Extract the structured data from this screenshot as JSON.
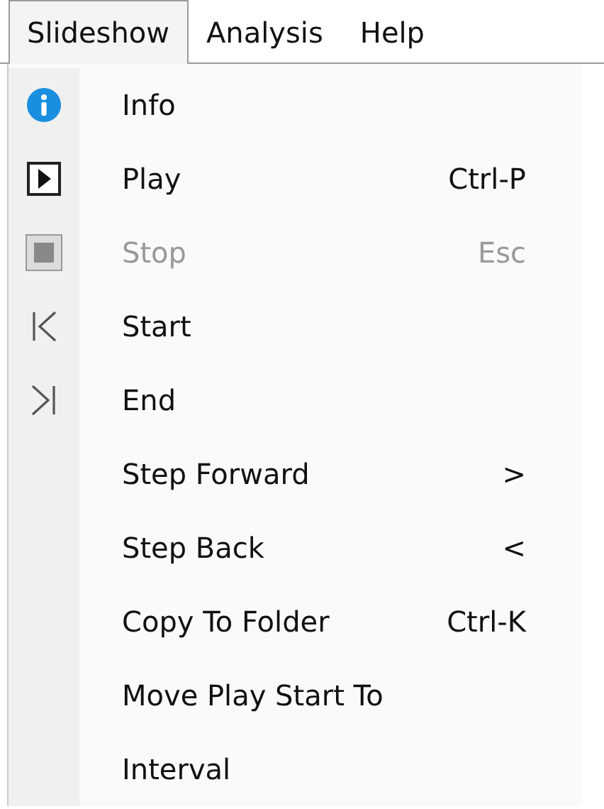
{
  "menubar": [
    {
      "label": "Slideshow",
      "selected": true
    },
    {
      "label": "Analysis",
      "selected": false
    },
    {
      "label": "Help",
      "selected": false
    }
  ],
  "menu": [
    {
      "label": "Info",
      "kind": "info",
      "disabled": false
    },
    {
      "label": "Play",
      "kind": "play",
      "shortcut": "Ctrl-P",
      "disabled": false
    },
    {
      "label": "Stop",
      "kind": "stop",
      "shortcut": "Esc",
      "disabled": true
    },
    {
      "label": "Start",
      "kind": "start",
      "disabled": false
    },
    {
      "label": "End",
      "kind": "end",
      "disabled": false
    },
    {
      "label": "Step Forward",
      "shortcut": ">",
      "disabled": false
    },
    {
      "label": "Step Back",
      "shortcut": "<",
      "disabled": false
    },
    {
      "label": "Copy To Folder",
      "shortcut": "Ctrl-K",
      "disabled": false
    },
    {
      "label": "Move Play Start To",
      "disabled": false
    },
    {
      "label": "Interval",
      "disabled": false
    }
  ]
}
